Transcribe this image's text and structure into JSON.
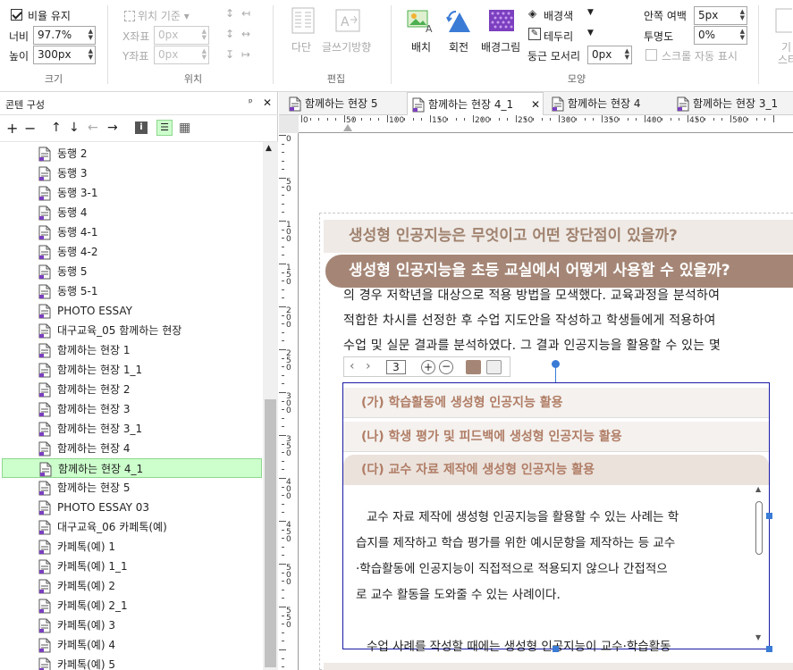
{
  "ribbon": {
    "size_group": {
      "keep_ratio_label": "비율 유지",
      "keep_ratio_checked": true,
      "width_label": "너비",
      "width_value": "97.7%",
      "height_label": "높이",
      "height_value": "300px",
      "group_label": "크기"
    },
    "position_group": {
      "position_base_label": "위치 기준",
      "x_label": "X좌표",
      "x_value": "0px",
      "y_label": "Y좌표",
      "y_value": "0px",
      "group_label": "위치"
    },
    "edit_group": {
      "columns_label": "다단",
      "text_direction_label": "글쓰기방향",
      "group_label": "편집"
    },
    "shape_group": {
      "arrange_label": "배치",
      "rotate_label": "회전",
      "bg_image_label": "배경그림",
      "bg_color_label": "배경색",
      "border_label": "테두리",
      "corner_radius_label": "둥근 모서리",
      "corner_radius_value": "0px",
      "padding_label": "안쪽 여백",
      "padding_value": "5px",
      "opacity_label": "투명도",
      "opacity_value": "0%",
      "scroll_auto_label": "스크롤 자동 표시",
      "scroll_auto_checked": false,
      "group_label": "모양"
    },
    "cut_label_1": "기",
    "cut_label_2": "스타"
  },
  "panel": {
    "title": "콘텐 구성",
    "pin_label": "ᵖ",
    "close_label": "✕",
    "items": [
      {
        "label": "동행 2"
      },
      {
        "label": "동행 3"
      },
      {
        "label": "동행 3-1"
      },
      {
        "label": "동행 4"
      },
      {
        "label": "동행 4-1"
      },
      {
        "label": "동행 4-2"
      },
      {
        "label": "동행 5"
      },
      {
        "label": "동행 5-1"
      },
      {
        "label": "PHOTO ESSAY"
      },
      {
        "label": "대구교육_05 함께하는 현장"
      },
      {
        "label": "함께하는 현장 1"
      },
      {
        "label": "함께하는 현장 1_1"
      },
      {
        "label": "함께하는 현장 2"
      },
      {
        "label": "함께하는 현장 3"
      },
      {
        "label": "함께하는 현장 3_1"
      },
      {
        "label": "함께하는 현장 4"
      },
      {
        "label": "함께하는 현장 4_1",
        "selected": true
      },
      {
        "label": "함께하는 현장 5"
      },
      {
        "label": "PHOTO ESSAY 03"
      },
      {
        "label": "대구교육_06 카페톡(예)"
      },
      {
        "label": "카페톡(예) 1"
      },
      {
        "label": "카페톡(예) 1_1"
      },
      {
        "label": "카페톡(예) 2"
      },
      {
        "label": "카페톡(예) 2_1"
      },
      {
        "label": "카페톡(예) 3"
      },
      {
        "label": "카페톡(예) 4"
      },
      {
        "label": "카페톡(예) 5"
      }
    ]
  },
  "tabs": [
    {
      "label": "함께하는 현장 5",
      "active": false
    },
    {
      "label": "함께하는 현장 4_1",
      "active": true
    },
    {
      "label": "함께하는 현장 4",
      "active": false
    },
    {
      "label": "함께하는 현장 3_1",
      "active": false
    }
  ],
  "ruler": {
    "h_labels": [
      "0",
      "50",
      "100",
      "150",
      "200",
      "250",
      "300",
      "350",
      "400",
      "450",
      "500"
    ],
    "v_labels": [
      "0",
      "50",
      "100",
      "150",
      "200",
      "250",
      "300",
      "350",
      "400",
      "450",
      "500",
      "550"
    ]
  },
  "document": {
    "heading1": "생성형 인공지능은 무엇이고 어떤 장단점이 있을까?",
    "heading2": "생성형 인공지능을 초등 교실에서 어떻게 사용할 수 있을까?",
    "body_lines": [
      "의 경우 저학년을 대상으로 적용 방법을 모색했다. 교육과정을 분석하여",
      "적합한 차시를 선정한 후 수업 지도안을 작성하고 학생들에게 적용하여",
      "수업 및 실문 결과를 분석하였다. 그 결과 인공지능을 활용할 수 있는 몇"
    ],
    "mini_toolbar_page": "3",
    "accordion": [
      {
        "label": "(가) 학습활동에 생성형 인공지능 활용"
      },
      {
        "label": "(나) 학생 평가 및 피드백에 생성형 인공지능 활용"
      },
      {
        "label": "(다) 교수 자료 제작에 생성형 인공지능 활용"
      }
    ],
    "inner_lines": [
      "교수 자료 제작에 생성형 인공지능을 활용할 수 있는 사례는 학",
      "습지를 제작하고 학습 평가를 위한 예시문항을 제작하는 등 교수",
      "·학습활동에 인공지능이 직접적으로 적용되지 않으나 간접적으",
      "로 교수 활동을 도와줄 수 있는 사례이다.",
      "",
      "수업 사례를 작성할 때에는 생성형 인공지능이 교수·학습활동"
    ]
  },
  "colors": {
    "heading1_bg": "#efeae6",
    "heading1_text": "#a0826f",
    "heading2_bg": "#a58676",
    "accordion_text": "#b07d66",
    "selected_item_bg": "#ccffcc",
    "selection_border": "#1a1aa6",
    "handle_color": "#3a7bd5"
  }
}
